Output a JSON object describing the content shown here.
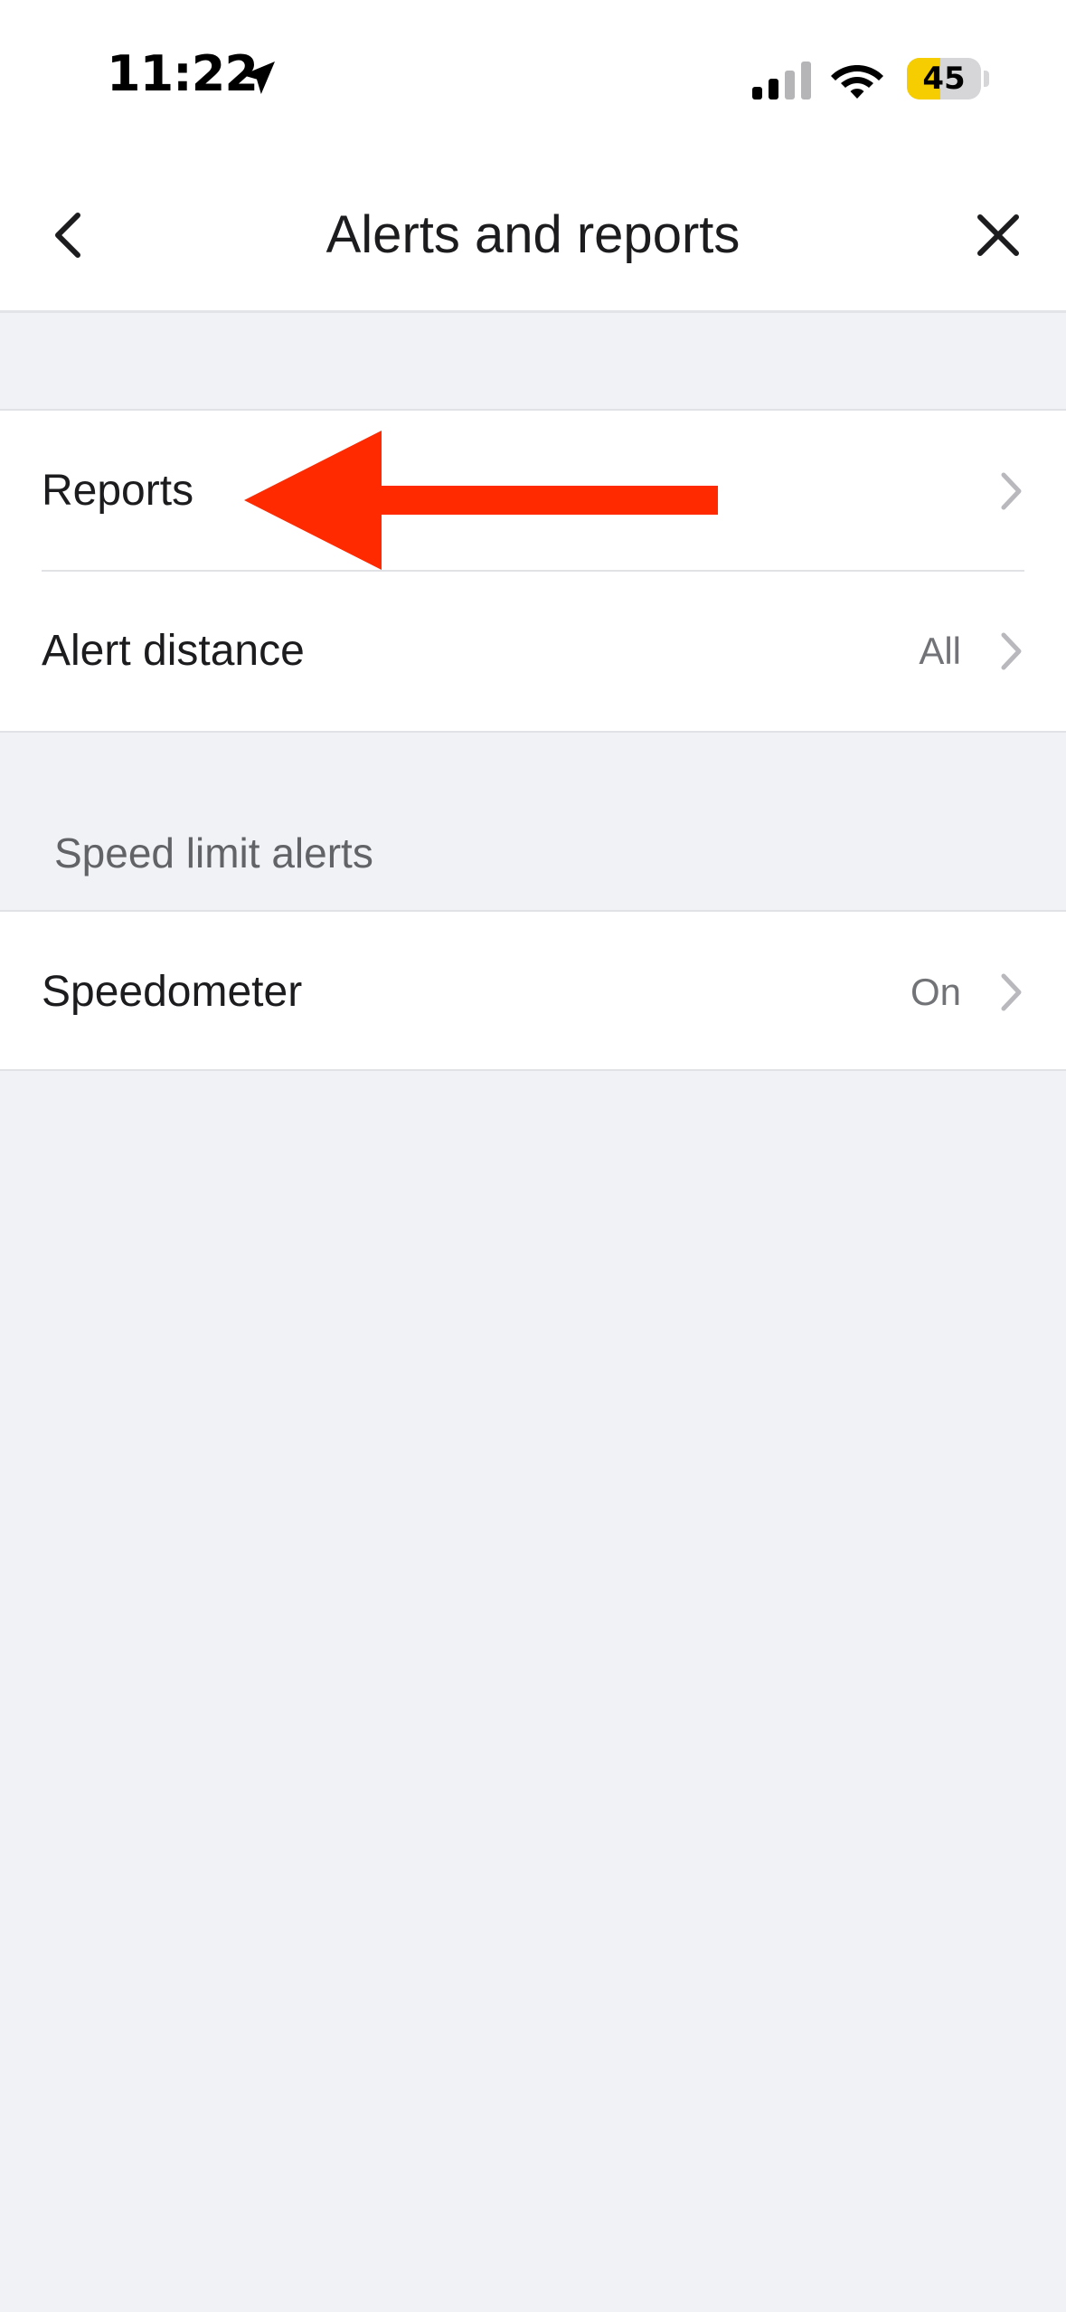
{
  "status_bar": {
    "time": "11:22",
    "battery_level": "45",
    "battery_fraction": 0.45,
    "icons": [
      "location-arrow-icon",
      "cellular-signal-icon",
      "wifi-icon",
      "battery-icon"
    ]
  },
  "header": {
    "title": "Alerts and reports",
    "back_icon": "chevron-left-icon",
    "close_icon": "close-icon"
  },
  "settings": {
    "group1": [
      {
        "label": "Reports",
        "value": ""
      },
      {
        "label": "Alert distance",
        "value": "All"
      }
    ],
    "section_header": "Speed limit alerts",
    "group2": [
      {
        "label": "Speedometer",
        "value": "On"
      }
    ]
  },
  "annotation": {
    "icon": "red-arrow-icon",
    "color": "#ff2a00"
  },
  "colors": {
    "background": "#f1f2f6",
    "surface": "#ffffff",
    "battery_accent": "#f5cd00",
    "text_primary": "#1c1c1e",
    "text_secondary": "#727377",
    "chevron": "#b9b9bd"
  }
}
